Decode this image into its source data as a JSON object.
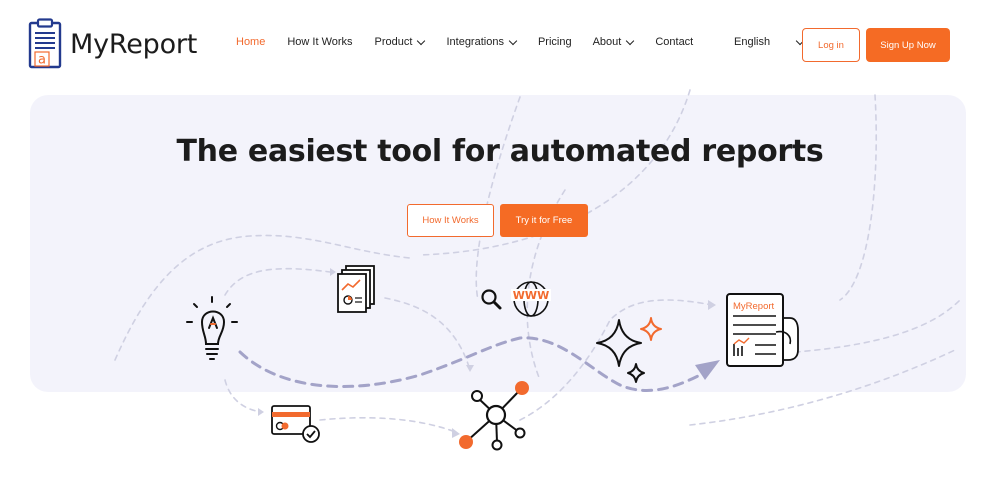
{
  "brand": {
    "name": "MyReport",
    "logo_letter": "a",
    "accent": "#f26a2e"
  },
  "nav": {
    "items": [
      {
        "label": "Home",
        "active": true,
        "dropdown": false
      },
      {
        "label": "How It Works",
        "active": false,
        "dropdown": false
      },
      {
        "label": "Product",
        "active": false,
        "dropdown": true
      },
      {
        "label": "Integrations",
        "active": false,
        "dropdown": true
      },
      {
        "label": "Pricing",
        "active": false,
        "dropdown": false
      },
      {
        "label": "About",
        "active": false,
        "dropdown": true
      },
      {
        "label": "Contact",
        "active": false,
        "dropdown": false
      }
    ],
    "language": "English",
    "login_label": "Log in",
    "signup_label": "Sign Up Now"
  },
  "hero": {
    "title": "The easiest tool for automated reports",
    "how_label": "How It Works",
    "try_label": "Try it for Free",
    "report_card_label": "MyReport",
    "www_label": "WWW",
    "icons": [
      "lightbulb-icon",
      "documents-chart-icon",
      "search-icon",
      "globe-icon",
      "sparkles-icon",
      "report-in-hand-icon",
      "network-hub-icon",
      "credit-card-check-icon"
    ]
  },
  "colors": {
    "accent": "#f26a2e",
    "button_fill": "#f56b24",
    "hero_bg": "#f3f3fb",
    "dash": "#c9c9dd",
    "dash_strong": "#a8a8cc"
  }
}
